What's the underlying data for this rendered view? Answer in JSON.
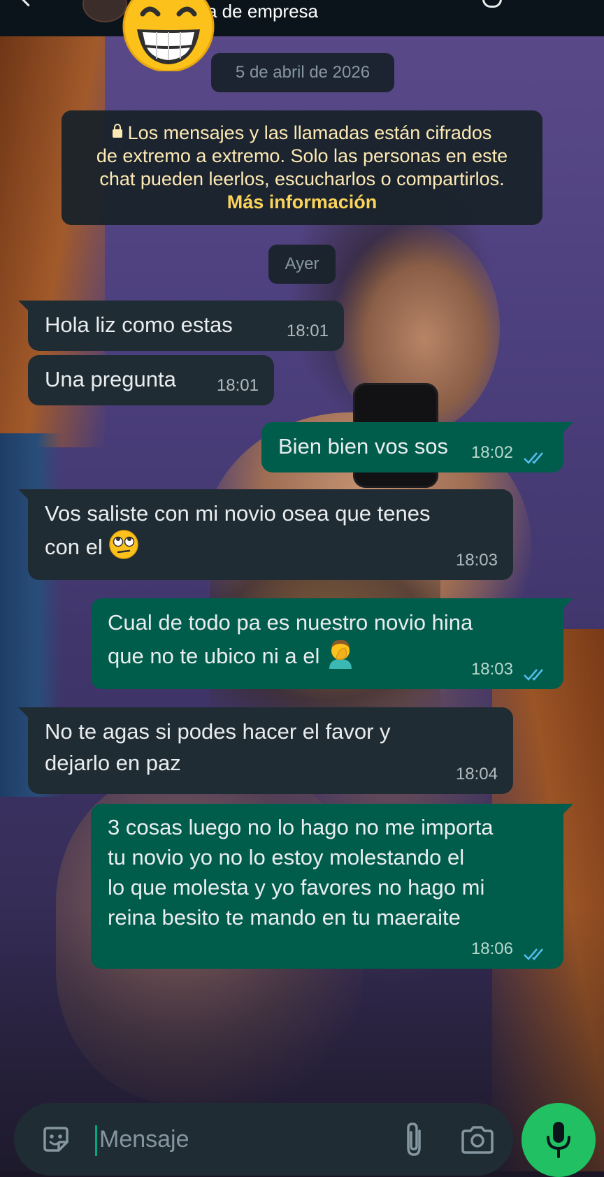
{
  "header": {
    "subtitle": "a de empresa"
  },
  "date_separator": "5 de abril de 2026",
  "encryption_notice": {
    "line1": "Los mensajes y las llamadas están cifrados",
    "line2": "de extremo a extremo. Solo las personas en este",
    "line3": "chat pueden leerlos, escucharlos o compartirlos.",
    "link": "Más información"
  },
  "day_separator": "Ayer",
  "messages": [
    {
      "direction": "in",
      "lines": [
        "Hola liz como estas"
      ],
      "time": "18:01"
    },
    {
      "direction": "in",
      "lines": [
        "Una pregunta"
      ],
      "time": "18:01"
    },
    {
      "direction": "out",
      "lines": [
        "Bien bien vos sos"
      ],
      "time": "18:02",
      "status": "read"
    },
    {
      "direction": "in",
      "lines": [
        "Vos saliste con mi novio osea que tenes",
        "con el"
      ],
      "emoji": "face-with-rolling-eyes",
      "time": "18:03"
    },
    {
      "direction": "out",
      "lines": [
        "Cual de todo pa es nuestro novio hina",
        "que no te ubico ni a el"
      ],
      "emoji": "person-facepalming",
      "time": "18:03",
      "status": "read"
    },
    {
      "direction": "in",
      "lines": [
        "No te agas si podes hacer el favor y",
        "dejarlo en paz"
      ],
      "time": "18:04"
    },
    {
      "direction": "out",
      "lines": [
        "3 cosas luego no lo hago no me importa",
        "tu novio yo no lo estoy molestando el",
        "lo que molesta y yo favores no hago mi",
        "reina besito te mando en tu maeraite"
      ],
      "time": "18:06",
      "status": "read"
    }
  ],
  "composer": {
    "placeholder": "Mensaje",
    "value": ""
  },
  "colors": {
    "incoming_bubble": "#202c33",
    "outgoing_bubble": "#005c4b",
    "accent_green": "#21c063",
    "read_tick": "#53bdeb",
    "notice_text": "#fde9b3",
    "notice_link": "#fcd45a"
  },
  "icons": [
    "grinning-face-sticker",
    "lock-icon",
    "double-check-icon",
    "sticker-icon",
    "attach-icon",
    "camera-icon",
    "mic-icon"
  ]
}
